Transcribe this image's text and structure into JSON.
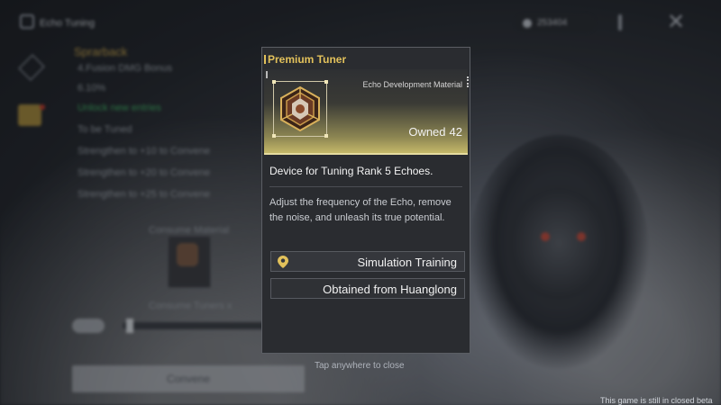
{
  "background": {
    "window_title": "Echo Tuning",
    "currency_value": "253404",
    "left_panel": {
      "title": "Sprarback",
      "lines": [
        "4.Fusion DMG Bonus",
        "6.10%",
        "Unlock new entries",
        "To be Tuned",
        "Strengthen to +10 to Convene",
        "Strengthen to +20 to Convene",
        "Strengthen to +25 to Convene"
      ],
      "material_label": "Consume Material",
      "tuning_label": "Consume Tuners x",
      "convene_button": "Convene"
    },
    "tap_hint": "Tap anywhere to close",
    "beta_notice": "This game is still in closed beta"
  },
  "modal": {
    "title": "Premium Tuner",
    "category": "Echo Development Material",
    "owned_label": "Owned",
    "owned_count": "42",
    "summary": "Device for Tuning Rank 5 Echoes.",
    "description": "Adjust the frequency of the Echo, remove the noise, and unleash its true potential.",
    "sources": [
      {
        "label": "Simulation Training",
        "icon": "location-pin-icon"
      },
      {
        "label": "Obtained from Huanglong",
        "icon": ""
      }
    ]
  },
  "colors": {
    "title_gold": "#e2c15b",
    "hero_gold": "#c8bb6a",
    "panel_bg": "#2a2c30"
  }
}
